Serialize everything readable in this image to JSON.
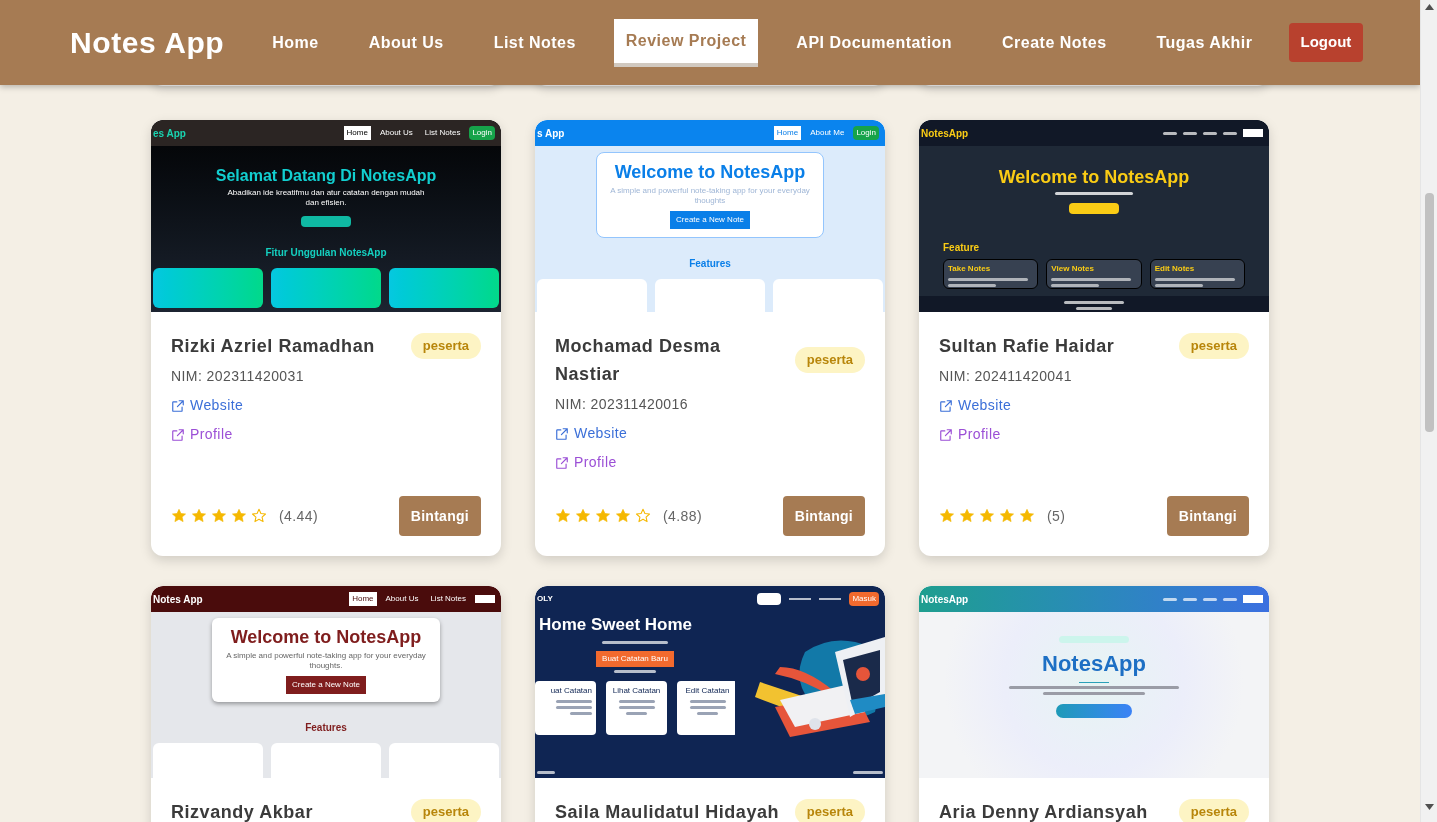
{
  "navbar": {
    "brand": "Notes App",
    "links": [
      {
        "label": "Home",
        "selected": false
      },
      {
        "label": "About Us",
        "selected": false
      },
      {
        "label": "List Notes",
        "selected": false
      },
      {
        "label": "Review Project",
        "selected": true
      },
      {
        "label": "API Documentation",
        "selected": false
      },
      {
        "label": "Create Notes",
        "selected": false
      },
      {
        "label": "Tugas Akhir",
        "selected": false
      }
    ],
    "logout": "Logout"
  },
  "projects": [
    {
      "name": "Rizki Azriel Ramadhan",
      "badge": "peserta",
      "nim": "NIM: 202311420031",
      "website": "Website",
      "profile": "Profile",
      "stars": 4,
      "rating": "(4.44)",
      "button": "Bintangi",
      "thumbnail": {
        "kind": "dark",
        "logo": "es App",
        "links": [
          {
            "label": "Home",
            "selected": true
          },
          {
            "label": "About Us",
            "selected": false
          },
          {
            "label": "List Notes",
            "selected": false
          }
        ],
        "login": "Login",
        "title": "Selamat Datang Di NotesApp",
        "subtitle": "Abadikan ide kreatifmu dan atur catatan dengan mudah dan efisien.",
        "section": "Fitur Unggulan NotesApp"
      }
    },
    {
      "name": "Mochamad Desma Nastiar",
      "badge": "peserta",
      "nim": "NIM: 202311420016",
      "website": "Website",
      "profile": "Profile",
      "stars": 4,
      "rating": "(4.88)",
      "button": "Bintangi",
      "thumbnail": {
        "kind": "blue",
        "logo": "s App",
        "links": [
          {
            "label": "Home",
            "selected": true
          },
          {
            "label": "About Me",
            "selected": false
          }
        ],
        "login": "Login",
        "title": "Welcome to NotesApp",
        "subtitle": "A simple and powerful note-taking app for your everyday thoughts",
        "button": "Create a New Note",
        "section": "Features"
      }
    },
    {
      "name": "Sultan Rafie Haidar",
      "badge": "peserta",
      "nim": "NIM: 202411420041",
      "website": "Website",
      "profile": "Profile",
      "stars": 5,
      "rating": "(5)",
      "button": "Bintangi",
      "thumbnail": {
        "kind": "navy",
        "logo": "NotesApp",
        "title": "Welcome to NotesApp",
        "section": "Feature",
        "features": [
          "Take Notes",
          "View Notes",
          "Edit Notes"
        ]
      }
    },
    {
      "name": "Rizvandy Akbar",
      "badge": "peserta",
      "thumbnail": {
        "kind": "maroon",
        "logo": "Notes App",
        "links": [
          {
            "label": "Home",
            "selected": true
          },
          {
            "label": "About Us",
            "selected": false
          },
          {
            "label": "List Notes",
            "selected": false
          }
        ],
        "title": "Welcome to NotesApp",
        "subtitle": "A simple and powerful note-taking app for your everyday thoughts.",
        "button": "Create a New Note",
        "section": "Features"
      }
    },
    {
      "name": "Saila Maulidatul Hidayah",
      "badge": "peserta",
      "thumbnail": {
        "kind": "illustrated",
        "logo": "OLY",
        "login": "Masuk",
        "title": "Home Sweet Home",
        "button": "Buat Catatan Baru",
        "features": [
          "uat Catatan",
          "Lihat Catatan",
          "Edit Catatan"
        ]
      }
    },
    {
      "name": "Aria Denny Ardiansyah",
      "badge": "peserta",
      "thumbnail": {
        "kind": "gradient",
        "logo": "NotesApp",
        "title": "NotesApp"
      }
    }
  ]
}
